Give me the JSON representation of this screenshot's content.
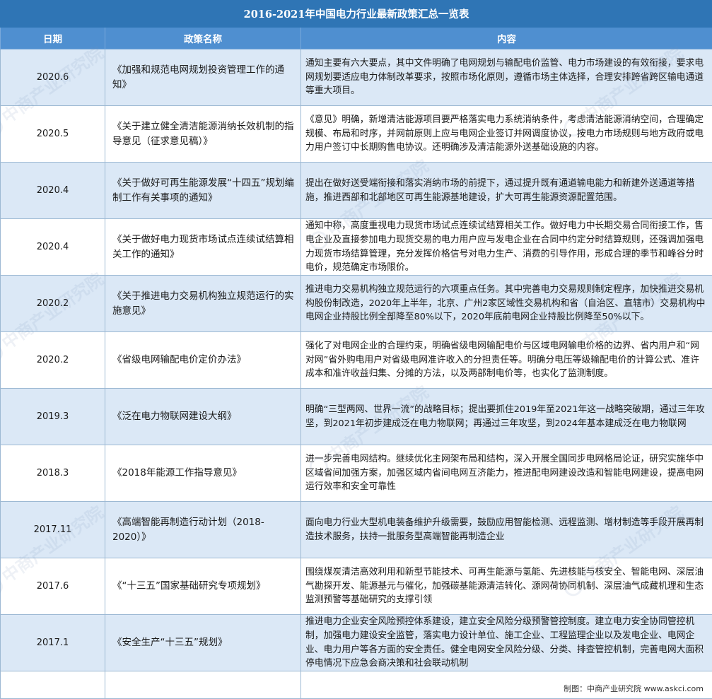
{
  "title": "2016-2021年中国电力行业最新政策汇总一览表",
  "columns": {
    "date": "日期",
    "name": "政策名称",
    "content": "内容"
  },
  "rows": [
    {
      "date": "2020.6",
      "name": "《加强和规范电网规划投资管理工作的通知》",
      "content": "通知主要有六大要点，其中文件明确了电网规划与输配电价监管、电力市场建设的有效衔接，要求电网规划要适应电力体制改革要求，按照市场化原则，遵循市场主体选择，合理安排跨省跨区输电通道等重大项目。"
    },
    {
      "date": "2020.5",
      "name": "《关于建立健全清洁能源消纳长效机制的指导意见（征求意见稿）》",
      "content": "《意见》明确，新增清洁能源项目要严格落实电力系统消纳条件，考虑清洁能源消纳空间，合理确定规模、布局和时序，并网前原则上应与电网企业签订并网调度协议，按电力市场规则与地方政府或电力用户签订中长期购售电协议。还明确涉及清洁能源外送基础设施的内容。"
    },
    {
      "date": "2020.4",
      "name": "《关于做好可再生能源发展“十四五”规划编制工作有关事项的通知》",
      "content": "提出在做好送受端衔接和落实消纳市场的前提下，通过提升既有通道输电能力和新建外送通道等措施，推进西部和北部地区可再生能源基地建设，扩大可再生能源资源配置范围。"
    },
    {
      "date": "2020.4",
      "name": "《关于做好电力现货市场试点连续试结算相关工作的通知》",
      "content": "通知中称，高度重视电力现货市场试点连续试结算相关工作。做好电力中长期交易合同衔接工作，售电企业及直接参加电力现货交易的电力用户应与发电企业在合同中约定分时结算规则，还强调加强电力现货市场结算管理，充分发挥价格信号对电力生产、消费的引导作用，形成合理的季节和峰谷分时电价，规范确定市场限价。"
    },
    {
      "date": "2020.2",
      "name": "《关于推进电力交易机构独立规范运行的实施意见》",
      "content": "推进电力交易机构独立规范运行的六项重点任务。其中完善电力交易规则制定程序，加快推进交易机构股份制改造，2020年上半年，北京、广州2家区域性交易机构和省（自治区、直辖市）交易机构中电网企业持股比例全部降至80%以下，2020年底前电网企业持股比例降至50%以下。"
    },
    {
      "date": "2020.2",
      "name": "《省级电网输配电价定价办法》",
      "content": "强化了对电网企业的合理约束，明确省级电网输配电价与区域电网输电价格的边界、省内用户和“网对网”省外购电用户对省级电网准许收入的分担责任等。明确分电压等级输配电价的计算公式、准许成本和准许收益归集、分摊的方法，以及两部制电价等，也实化了监测制度。"
    },
    {
      "date": "2019.3",
      "name": "《泛在电力物联网建设大纲》",
      "content": "明确“三型两网、世界一流”的战略目标；提出要抓住2019年至2021年这一战略突破期，通过三年攻坚，到2021年初步建成泛在电力物联网；再通过三年攻坚，到2024年基本建成泛在电力物联网"
    },
    {
      "date": "2018.3",
      "name": "《2018年能源工作指导意见》",
      "content": "进一步完善电网结构。继续优化主网架布局和结构，深入开展全国同步电网格局论证，研究实施华中区域省间加强方案，加强区域内省间电网互济能力，推进配电网建设改造和智能电网建设，提高电网运行效率和安全可靠性"
    },
    {
      "date": "2017.11",
      "name": "《高端智能再制造行动计划（2018-2020）》",
      "content": "面向电力行业大型机电装备维护升级需要，鼓励应用智能检测、远程监测、增材制造等手段开展再制造技术服务，扶持一批服务型高端智能再制造企业"
    },
    {
      "date": "2017.6",
      "name": "《“十三五”国家基础研究专项规划》",
      "content": "围绕煤炭清洁高效利用和新型节能技术、可再生能源与氢能、先进核能与核安全、智能电网、深层油气勘探开发、能源基元与催化，加强碳基能源清洁转化、源网荷协同机制、深层油气成藏机理和生态监测预警等基础研究的支撑引领"
    },
    {
      "date": "2017.1",
      "name": "《安全生产“十三五”规划》",
      "content": "推进电力企业安全风险预控体系建设，建立安全风险分级预警管控制度。建立电力安全协同管控机制，加强电力建设安全监管，落实电力设计单位、施工企业、工程监理企业以及发电企业、电网企业、电力用户等各方面的安全责任。健全电网安全风险分级、分类、排查管控机制，完善电网大面积停电情况下应急会商决策和社会联动机制"
    }
  ],
  "source": "制图：中商产业研究院 www.askci.com",
  "watermark": "中商产业研究院"
}
